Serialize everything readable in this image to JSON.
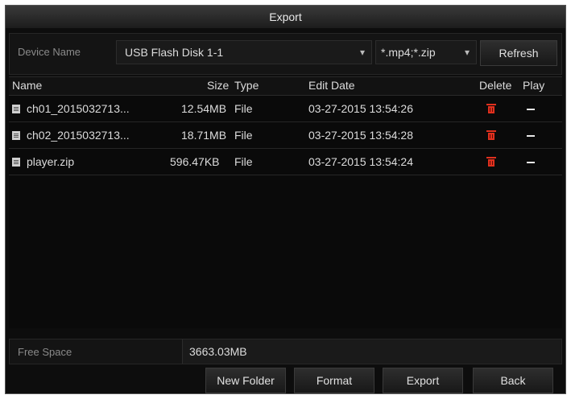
{
  "window": {
    "title": "Export"
  },
  "toolbar": {
    "device_label": "Device Name",
    "device_value": "USB Flash Disk 1-1",
    "filter_value": "*.mp4;*.zip",
    "refresh_label": "Refresh"
  },
  "table": {
    "headers": {
      "name": "Name",
      "size": "Size",
      "type": "Type",
      "edit_date": "Edit Date",
      "delete": "Delete",
      "play": "Play"
    },
    "rows": [
      {
        "name": "ch01_2015032713...",
        "size": "12.54MB",
        "type": "File",
        "edit_date": "03-27-2015 13:54:26",
        "play": "—"
      },
      {
        "name": "ch02_2015032713...",
        "size": "18.71MB",
        "type": "File",
        "edit_date": "03-27-2015 13:54:28",
        "play": "—"
      },
      {
        "name": "player.zip",
        "size": "596.47KB",
        "type": "File",
        "edit_date": "03-27-2015 13:54:24",
        "play": "—"
      }
    ]
  },
  "free_space": {
    "label": "Free Space",
    "value": "3663.03MB"
  },
  "buttons": {
    "new_folder": "New Folder",
    "format": "Format",
    "export": "Export",
    "back": "Back"
  },
  "colors": {
    "background": "#0d0d0d",
    "delete_icon": "#e0301e",
    "text": "#dcdcdc"
  },
  "icons": {
    "file": "file-icon",
    "delete": "trash-icon",
    "play": "dash-icon",
    "dropdown": "chevron-down-icon"
  }
}
